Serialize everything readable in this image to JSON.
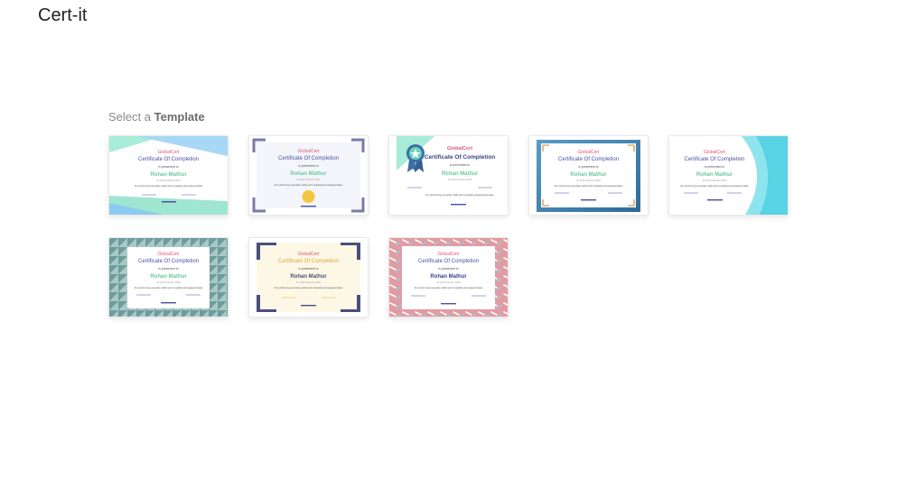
{
  "app": {
    "title": "Cert-it"
  },
  "section": {
    "label_prefix": "Select a",
    "label_strong": "Template"
  },
  "templates": [
    {
      "brand": "GlobalCert",
      "title": "Certificate Of Completion",
      "presented": "is presented to",
      "name": "Rohan Mathur",
      "date": "for 23rd February 2020",
      "body": "For performing exemplary skills and completing all assigned tasks"
    },
    {
      "brand": "GlobalCert",
      "title": "Certificate Of Completion",
      "presented": "is presented to",
      "name": "Rohan Mathur",
      "date": "for 23rd February 2020",
      "body": "For performing exemplary skills and completing all assigned tasks"
    },
    {
      "brand": "GlobalCert",
      "title": "Certificate Of Completion",
      "presented": "is presented to",
      "name": "Rohan Mathur",
      "date": "for 23rd February 2020",
      "body": "For performing exemplary skills and completing all assigned tasks"
    },
    {
      "brand": "GlobalCert",
      "title": "Certificate Of Completion",
      "presented": "is presented to",
      "name": "Rohan Mathur",
      "date": "for 23rd February 2020",
      "body": "For performing exemplary skills and completing all assigned tasks"
    },
    {
      "brand": "GlobalCert",
      "title": "Certificate Of Completion",
      "presented": "is presented to",
      "name": "Rohan Mathur",
      "date": "for 23rd February 2020",
      "body": "For performing exemplary skills and completing all assigned tasks"
    },
    {
      "brand": "GlobalCert",
      "title": "Certificate Of Completion",
      "presented": "is presented to",
      "name": "Rohan Mathur",
      "date": "for 23rd February 2020",
      "body": "For performing exemplary skills and completing all assigned tasks"
    },
    {
      "brand": "GlobalCert",
      "title": "Certificate Of Completion",
      "presented": "is presented to",
      "name": "Rohan Mathur",
      "date": "for 23rd February 2020",
      "body": "For performing exemplary skills and completing all assigned tasks"
    },
    {
      "brand": "GlobalCert",
      "title": "Certificate Of Completion",
      "presented": "is presented to",
      "name": "Rohan Mathur",
      "date": "for 23rd February 2020",
      "body": "For performing exemplary skills and completing all assigned tasks"
    }
  ],
  "colors": {
    "brand_text": "#e0567a",
    "title_text": "#4a4fa3",
    "name_text": "#6cc9a0",
    "body_text": "#555555"
  }
}
